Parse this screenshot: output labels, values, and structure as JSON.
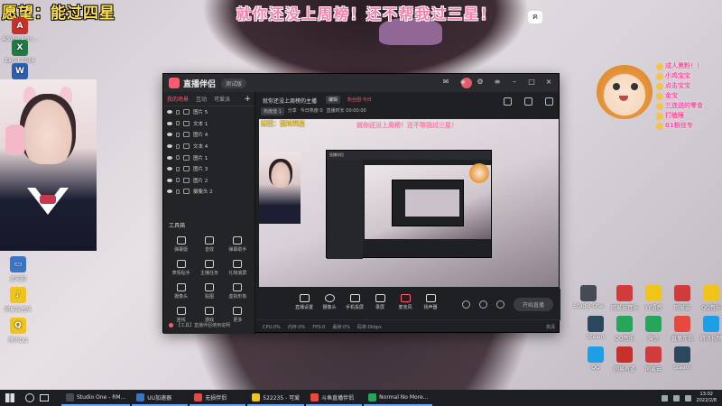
{
  "overlay": {
    "top_left": "愿望：能过四星",
    "top_center": "就你还没上周榜！还不帮我过三星！"
  },
  "desktop_icons_left": [
    {
      "label": "Adobe Acro...",
      "icon": "pdf-icon",
      "color": "#c9302c"
    },
    {
      "label": "Excel 2016",
      "icon": "excel-icon",
      "color": "#1f7a43"
    },
    {
      "label": "Word 2016",
      "icon": "word-icon",
      "color": "#2b5fb4"
    },
    {
      "label": "此电脑",
      "icon": "computer-icon",
      "color": "#3a76c8"
    },
    {
      "label": "网易云音乐",
      "icon": "music-icon",
      "color": "#d23b3b"
    },
    {
      "label": "腾讯QQ",
      "icon": "qq-icon",
      "color": "#1f9ee8"
    }
  ],
  "desktop_icons_right": [
    {
      "label": "Studio One",
      "icon": "studio-one-icon",
      "color": "#444b55"
    },
    {
      "label": "网易云音乐",
      "icon": "music-icon",
      "color": "#d23b3b"
    },
    {
      "label": "YY语音",
      "icon": "yy-icon",
      "color": "#f0c419"
    },
    {
      "label": "网易云",
      "icon": "cloud-icon",
      "color": "#d23b3b"
    },
    {
      "label": "QQ音乐",
      "icon": "qqmusic-icon",
      "color": "#f0c419"
    },
    {
      "label": "Steam",
      "icon": "steam-icon",
      "color": "#2a475e"
    },
    {
      "label": "QQ音乐",
      "icon": "qqmusic-icon",
      "color": "#26a65b"
    },
    {
      "label": "微信",
      "icon": "wechat-icon",
      "color": "#26a65b"
    },
    {
      "label": "直播伴侣",
      "icon": "live-icon",
      "color": "#e8493f"
    },
    {
      "label": "腾讯视频",
      "icon": "video-icon",
      "color": "#1f9ee8"
    },
    {
      "label": "QQ",
      "icon": "qq-icon",
      "color": "#1f9ee8"
    },
    {
      "label": "网易有道",
      "icon": "dict-icon",
      "color": "#c9302c"
    },
    {
      "label": "网易云",
      "icon": "cloud-icon",
      "color": "#d23b3b"
    },
    {
      "label": "Steam",
      "icon": "steam-icon",
      "color": "#2a475e"
    }
  ],
  "sticker_gifts": [
    "成人黑粉！！",
    "小鸡宝宝",
    "点击宝宝",
    "金宝",
    "三连送的零食",
    "打瞌睡",
    "01粉丝专"
  ],
  "app": {
    "brand": "直播伴侣",
    "version": "测试版",
    "left_tabs": [
      "我的场景",
      "互动",
      "可爱派"
    ],
    "layers": [
      "图片 5",
      "文本 1",
      "图片 4",
      "文本 4",
      "图片 1",
      "图片 3",
      "图片 2",
      "摄像头 2"
    ],
    "tools_title": "工具箱",
    "tools": [
      "弹幕姬",
      "音效",
      "弹幕助手",
      "表情贴手",
      "主播任务",
      "礼物滚屏",
      "摄像头",
      "贴图",
      "虚拟形象",
      "连线",
      "游戏",
      "更多"
    ],
    "footer": "【工具】直播伴侣使用说明",
    "preview_title": "就你还没上周榜的主播",
    "edit_label": "编辑",
    "fans_label": "粉丝团·今日",
    "row2": [
      "热度值 1",
      "分享",
      "今日热度:0",
      "直播时长 00:00:00"
    ],
    "bottom_items": [
      "直播设置",
      "摄像头",
      "手机投屏",
      "录屏",
      "麦克风",
      "扬声器"
    ],
    "start_live": "开始直播",
    "status": [
      "CPU:0%",
      "内存:0%",
      "FPS:0",
      "丢帧:0%",
      "码率:0kbps"
    ],
    "status_hd": "高清"
  },
  "taskbar": {
    "items": [
      {
        "label": "Studio One - RM...",
        "color": "#444b55"
      },
      {
        "label": "UU加速器",
        "color": "#3a76c8"
      },
      {
        "label": "无损伴侣",
        "color": "#e8493f"
      },
      {
        "label": "522235 - 可爱",
        "color": "#f0c419"
      },
      {
        "label": "斗鱼直播伴侣",
        "color": "#e8493f"
      },
      {
        "label": "Normal No More...",
        "color": "#26a65b"
      }
    ],
    "time": "13:02",
    "date": "2022/2/8"
  }
}
